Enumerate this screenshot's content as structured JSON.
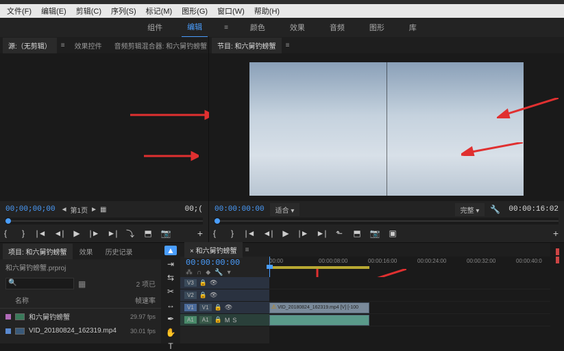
{
  "menubar": [
    "文件(F)",
    "编辑(E)",
    "剪辑(C)",
    "序列(S)",
    "标记(M)",
    "图形(G)",
    "窗口(W)",
    "帮助(H)"
  ],
  "workspace_tabs": [
    {
      "label": "组件",
      "active": false
    },
    {
      "label": "编辑",
      "active": true
    },
    {
      "label": "颜色",
      "active": false
    },
    {
      "label": "效果",
      "active": false
    },
    {
      "label": "音频",
      "active": false
    },
    {
      "label": "图形",
      "active": false
    },
    {
      "label": "库",
      "active": false
    }
  ],
  "source": {
    "tabs": [
      {
        "label": "源:（无剪辑）",
        "active": true
      },
      {
        "label": "效果控件",
        "active": false
      },
      {
        "label": "音频剪辑混合器: 和六舅钓螃蟹",
        "active": false
      }
    ],
    "timecode": "00;00;00;00",
    "page": "第1页",
    "right_tc": "00;(",
    "buttons": [
      "mark-in",
      "mark-out",
      "go-in",
      "step-back",
      "play",
      "step-fwd",
      "go-out",
      "insert",
      "overwrite",
      "export-frame"
    ]
  },
  "program": {
    "tab": "节目: 和六舅钓螃蟹",
    "timecode": "00:00:00:00",
    "fit": "适合",
    "zoom": "完整",
    "duration": "00:00:16:02",
    "buttons": [
      "mark-in",
      "mark-out",
      "go-in",
      "step-back",
      "play",
      "step-fwd",
      "go-out",
      "lift",
      "extract",
      "export-frame",
      "safe-margins"
    ]
  },
  "project": {
    "tabs": [
      {
        "label": "项目: 和六舅钓螃蟹",
        "active": true
      },
      {
        "label": "效果",
        "active": false
      },
      {
        "label": "历史记录",
        "active": false
      }
    ],
    "bin": "和六舅钓螃蟹.prproj",
    "count": "2 项已",
    "columns": {
      "name": "名称",
      "fps": "帧速率"
    },
    "items": [
      {
        "type": "seq",
        "color": "#b06ab8",
        "name": "和六舅钓螃蟹",
        "fps": "29.97 fps"
      },
      {
        "type": "clip",
        "color": "#5a8ad0",
        "name": "VID_20180824_162319.mp4",
        "fps": "30.01 fps"
      }
    ]
  },
  "tools": [
    "selection",
    "track-select",
    "ripple",
    "razor",
    "slip",
    "pen",
    "hand",
    "type"
  ],
  "timeline": {
    "tab": "和六舅钓螃蟹",
    "timecode": "00:00:00:00",
    "ticks": [
      "00:00",
      "00:00:08:00",
      "00:00:16:00",
      "00:00:24:00",
      "00:00:32:00",
      "00:00:40:0"
    ],
    "video_tracks": [
      "V3",
      "V2",
      "V1"
    ],
    "audio_tracks": [
      "A1"
    ],
    "clip_name": "VID_20180824_162319.mp4 [V] [-100"
  }
}
